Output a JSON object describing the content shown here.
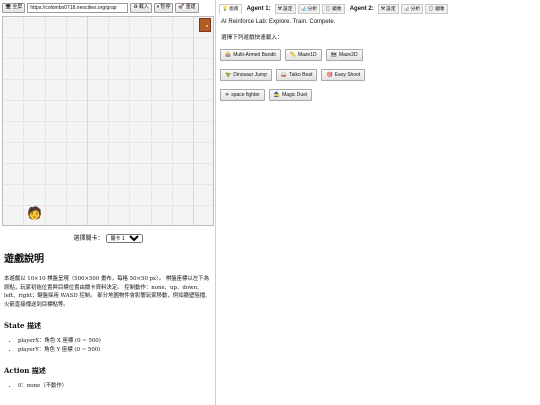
{
  "toolbar": {
    "fullscreen_label": "全屏",
    "url_value": "https://colombo0718.neocities.org/grap",
    "load_label": "載入",
    "pause_label": "暫停",
    "reset_label": "重建"
  },
  "level_select": {
    "label": "選擇關卡：",
    "selected": "關卡 1"
  },
  "doc": {
    "title": "遊戲說明",
    "paragraph": "本遊戲以 10×10 棋盤呈現（500×500 畫布，每格 50×50 px）。 棋盤座標以左下為原點，玩家初始位置與目標位置由關卡資料決定。 控制動作：none、up、down、left、right；鍵盤採用 WASD 控制。 部分地圖物件會影響玩家移動，例如牆壁阻擋、火箭直接傳送到目標點等。",
    "state_heading": "State 描述",
    "state_items": [
      "playerX：角色 X 座標 (0 ~ 500)",
      "playerY：角色 Y 座標 (0 ~ 500)"
    ],
    "action_heading": "Action 描述",
    "action_items": [
      "0：none（不動作）"
    ]
  },
  "tabs": {
    "guide": "指南",
    "agent1_label": "Agent 1:",
    "agent1_settings": "設定",
    "agent1_analysis": "分析",
    "agent1_mirror": "鏡象",
    "agent2_label": "Agent 2:",
    "agent2_settings": "設定",
    "agent2_analysis": "分析",
    "agent2_mirror": "鏡象"
  },
  "intro": "AI Reinforce Lab: Explore. Train. Compete.",
  "hint": "選擇下列遊戲快速載入：",
  "games": [
    "Multi-Armed Bandit",
    "Maze1D",
    "Maze2D",
    "Dinosaur Jump",
    "Taiko Beat",
    "Easy Shoot",
    "space fighter",
    "Magic Duel"
  ]
}
